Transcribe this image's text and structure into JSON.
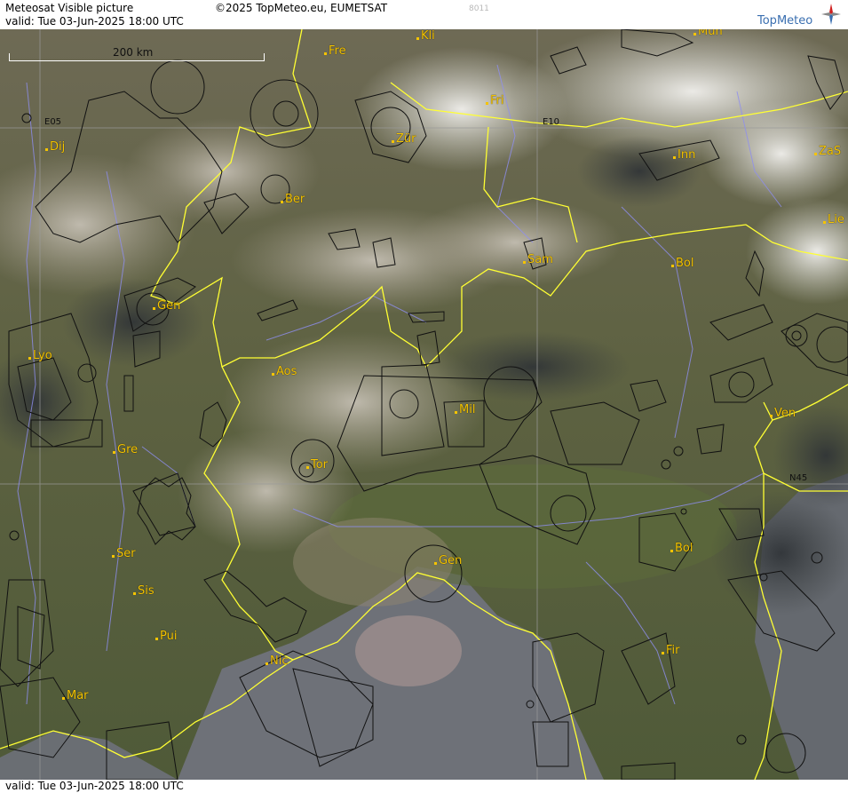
{
  "header": {
    "title": "Meteosat Visible picture",
    "valid": "valid:  Tue  03-Jun-2025  18:00 UTC",
    "copyright": "©2025 TopMeteo.eu, EUMETSAT",
    "code": "8011",
    "logo": "TopMeteo"
  },
  "footer": {
    "valid": "valid:  Tue  03-Jun-2025  18:00 UTC"
  },
  "scale_label": "200 km",
  "grid_labels": {
    "e05": "E05",
    "e10": "E10",
    "n45": "N45"
  },
  "cities": {
    "fre": "Fre",
    "kli": "Kli",
    "mun": "Mun",
    "fri": "Fri",
    "dij": "Dij",
    "zur": "Zür",
    "inn": "Inn",
    "zas": "ZaS",
    "ber": "Ber",
    "lie": "Lie",
    "sam": "Sam",
    "bol_n": "Bol",
    "gen_w": "Gen",
    "lyo": "Lyo",
    "aos": "Aos",
    "mil": "Mil",
    "ven": "Ven",
    "gre": "Gre",
    "tor": "Tor",
    "ser": "Ser",
    "gen_s": "Gen",
    "bol_s": "Bol",
    "sis": "Sis",
    "pui": "Pui",
    "nic": "Nic",
    "fir": "Fir",
    "mar": "Mar"
  },
  "colors": {
    "borders": "#ffff33",
    "rivers": "#8e8ef0",
    "airspace": "#111111",
    "labels": "#f5c400",
    "sea": "#6e7178"
  }
}
